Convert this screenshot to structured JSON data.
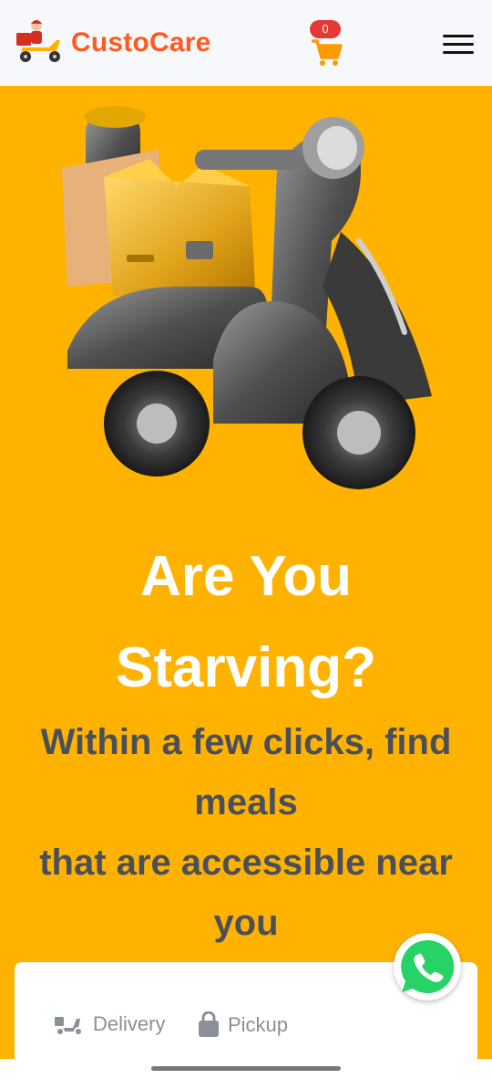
{
  "header": {
    "brand": "CustoCare",
    "cart_count": "0",
    "logo_icon": "delivery-rider-logo",
    "cart_icon": "cart-icon",
    "menu_icon": "hamburger-menu-icon"
  },
  "hero": {
    "image": "scooter-with-box-illustration",
    "title": "Are You Starving?",
    "subtitle_line1": "Within a few clicks, find meals",
    "subtitle_line2": "that are accessible near you"
  },
  "order_type": {
    "tabs": [
      {
        "label": "Delivery",
        "icon": "scooter-icon"
      },
      {
        "label": "Pickup",
        "icon": "shopping-bag-icon"
      }
    ]
  },
  "whatsapp": {
    "icon": "whatsapp-icon"
  },
  "colors": {
    "brand": "#ff5a1f",
    "hero_bg": "#ffb300",
    "header_bg": "#f7f8fb",
    "badge": "#e53935",
    "subtitle": "#4a4f5a",
    "whatsapp": "#25d366"
  }
}
